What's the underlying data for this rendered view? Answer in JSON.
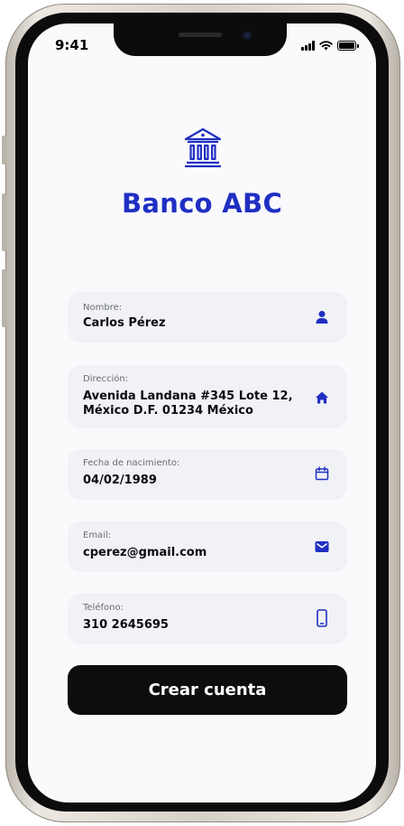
{
  "status_bar": {
    "time": "9:41",
    "icons": [
      "signal-icon",
      "wifi-icon",
      "battery-icon"
    ]
  },
  "app": {
    "brand_name": "Banco ABC",
    "logo_icon": "bank-icon",
    "accent_color": "#1f2fc2"
  },
  "form": {
    "fields": [
      {
        "label": "Nombre:",
        "value": "Carlos Pérez",
        "icon": "user-icon"
      },
      {
        "label": "Dirección:",
        "value_line1": "Avenida Landana #345 Lote 12,",
        "value_line2": "México D.F. 01234 México",
        "icon": "home-icon"
      },
      {
        "label": "Fecha de nacimiento:",
        "value": "04/02/1989",
        "icon": "calendar-icon"
      },
      {
        "label": "Email:",
        "value": "cperez@gmail.com",
        "icon": "mail-icon"
      },
      {
        "label": "Teléfono:",
        "value": "310 2645695",
        "icon": "phone-icon"
      }
    ],
    "submit_label": "Crear cuenta"
  }
}
